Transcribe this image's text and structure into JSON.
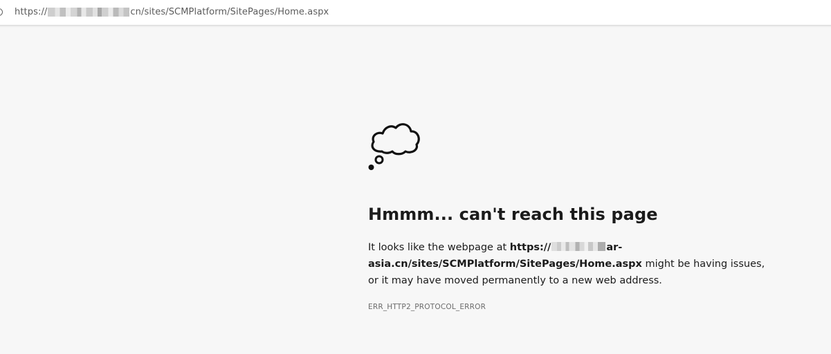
{
  "address_bar": {
    "url_prefix": "https://",
    "url_suffix": "cn/sites/SCMPlatform/SitePages/Home.aspx"
  },
  "icons": {
    "site_info": "site-info-icon",
    "illustration": "thought-cloud-icon"
  },
  "error_page": {
    "heading": "Hmmm... can't reach this page",
    "message_intro": "It looks like the webpage at ",
    "url_bold_prefix": "https://",
    "url_bold_suffix": "ar-asia.cn/sites/SCMPlatform/SitePages/Home.aspx",
    "message_outro": " might be having issues, or it may have moved permanently to a new web address.",
    "error_code": "ERR_HTTP2_PROTOCOL_ERROR"
  },
  "colors": {
    "page_background": "#f7f7f7",
    "text_primary": "#1b1b1b",
    "text_secondary": "#6b6b6b"
  }
}
